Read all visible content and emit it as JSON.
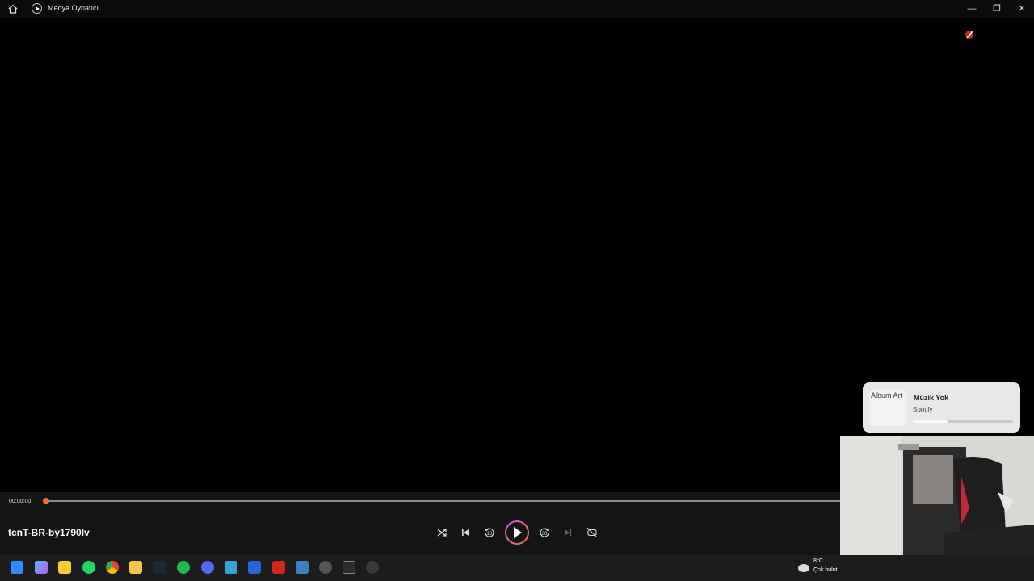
{
  "window": {
    "title": "Medya Oynatıcı",
    "controls": {
      "minimize": "—",
      "maximize": "❐",
      "close": "✕"
    }
  },
  "player": {
    "current_time": "00:00:00",
    "progress": 0,
    "media_title": "tcnT-BR-by1790lv",
    "buttons": [
      "shuffle",
      "previous",
      "rewind-10",
      "play",
      "forward-30",
      "next",
      "repeat"
    ],
    "rewind_label": "10",
    "forward_label": "30"
  },
  "spotify_widget": {
    "album_art_alt": "Album Art",
    "title": "Müzik Yok",
    "source": "Spotify",
    "progress": 0.35
  },
  "weather": {
    "temperature": "8°C",
    "condition": "Çok bulut"
  },
  "taskbar": {
    "apps": [
      "start",
      "copilot",
      "sticky-notes",
      "whatsapp",
      "chrome",
      "file-explorer",
      "steam",
      "spotify",
      "discord",
      "windows-app",
      "mail",
      "acrobat",
      "paint",
      "davinci",
      "terminal",
      "media-player"
    ]
  },
  "colors": {
    "accent_gradient_start": "#c05ad8",
    "accent_gradient_end": "#f0783c",
    "seek_thumb": "#e07040"
  }
}
